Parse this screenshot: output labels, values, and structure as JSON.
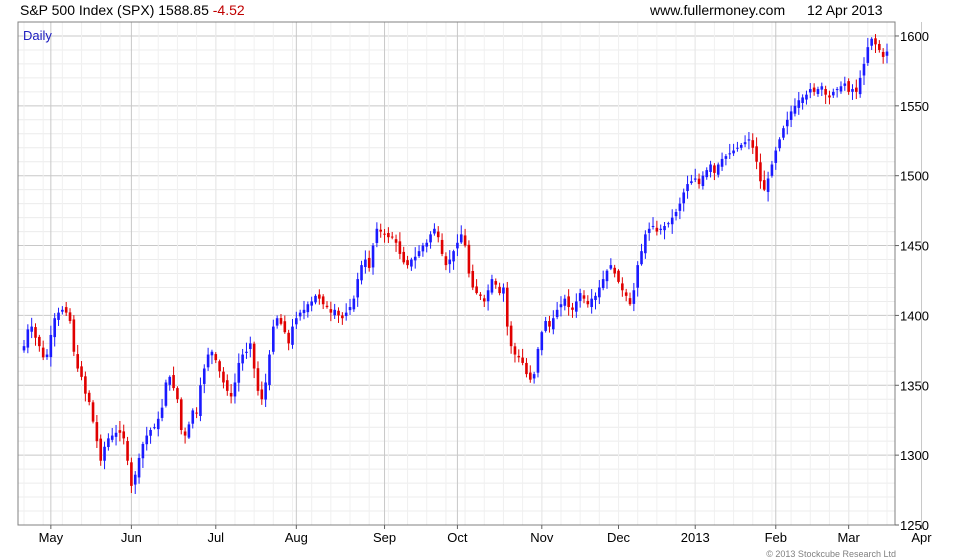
{
  "header": {
    "title": "S&P 500 Index (SPX)",
    "last": "1588.85",
    "change": "-4.52",
    "source": "www.fullermoney.com",
    "date": "12 Apr 2013"
  },
  "footer": {
    "copyright": "© 2013 Stockcube Research Ltd"
  },
  "colors": {
    "up": "#1a1aff",
    "down": "#e00000",
    "grid": "#dcdcdc",
    "frame": "#808080"
  },
  "chart_data": {
    "type": "candlestick",
    "frequency_label": "Daily",
    "ylim": [
      1250,
      1610
    ],
    "y_ticks": [
      1250,
      1300,
      1350,
      1400,
      1450,
      1500,
      1550,
      1600
    ],
    "x_ticks": [
      {
        "label": "May",
        "index": 7
      },
      {
        "label": "Jun",
        "index": 28
      },
      {
        "label": "Jul",
        "index": 50
      },
      {
        "label": "Aug",
        "index": 71
      },
      {
        "label": "Sep",
        "index": 94
      },
      {
        "label": "Oct",
        "index": 113
      },
      {
        "label": "Nov",
        "index": 135
      },
      {
        "label": "Dec",
        "index": 155
      },
      {
        "label": "2013",
        "index": 175
      },
      {
        "label": "Feb",
        "index": 196
      },
      {
        "label": "Mar",
        "index": 215
      },
      {
        "label": "Apr",
        "index": 234
      }
    ],
    "grid": true,
    "closes": [
      1378,
      1390,
      1392,
      1384,
      1378,
      1370,
      1372,
      1386,
      1398,
      1402,
      1404,
      1402,
      1396,
      1374,
      1362,
      1356,
      1344,
      1338,
      1324,
      1310,
      1296,
      1306,
      1312,
      1314,
      1316,
      1316,
      1312,
      1296,
      1278,
      1286,
      1298,
      1308,
      1314,
      1318,
      1320,
      1326,
      1334,
      1352,
      1356,
      1348,
      1340,
      1318,
      1314,
      1322,
      1332,
      1330,
      1350,
      1362,
      1372,
      1374,
      1368,
      1360,
      1352,
      1346,
      1342,
      1352,
      1366,
      1372,
      1374,
      1380,
      1362,
      1346,
      1340,
      1352,
      1372,
      1392,
      1398,
      1394,
      1388,
      1380,
      1392,
      1398,
      1402,
      1404,
      1408,
      1410,
      1414,
      1412,
      1408,
      1406,
      1402,
      1404,
      1400,
      1398,
      1402,
      1406,
      1412,
      1426,
      1436,
      1440,
      1434,
      1450,
      1462,
      1460,
      1458,
      1456,
      1456,
      1452,
      1444,
      1438,
      1436,
      1440,
      1442,
      1446,
      1450,
      1452,
      1458,
      1462,
      1456,
      1444,
      1436,
      1440,
      1446,
      1452,
      1458,
      1450,
      1430,
      1420,
      1416,
      1414,
      1410,
      1418,
      1426,
      1422,
      1416,
      1420,
      1392,
      1378,
      1372,
      1370,
      1366,
      1358,
      1354,
      1358,
      1376,
      1388,
      1396,
      1392,
      1398,
      1404,
      1408,
      1412,
      1406,
      1404,
      1410,
      1416,
      1412,
      1408,
      1412,
      1414,
      1420,
      1426,
      1432,
      1436,
      1430,
      1424,
      1418,
      1414,
      1408,
      1418,
      1436,
      1446,
      1458,
      1462,
      1464,
      1460,
      1462,
      1464,
      1466,
      1470,
      1474,
      1480,
      1488,
      1494,
      1496,
      1498,
      1494,
      1500,
      1504,
      1508,
      1502,
      1508,
      1512,
      1514,
      1516,
      1518,
      1520,
      1522,
      1524,
      1526,
      1520,
      1510,
      1496,
      1490,
      1498,
      1508,
      1518,
      1526,
      1534,
      1540,
      1546,
      1550,
      1554,
      1556,
      1558,
      1562,
      1560,
      1562,
      1564,
      1558,
      1556,
      1560,
      1562,
      1564,
      1566,
      1560,
      1562,
      1560,
      1570,
      1580,
      1592,
      1598,
      1594,
      1590,
      1585,
      1588.85
    ]
  }
}
